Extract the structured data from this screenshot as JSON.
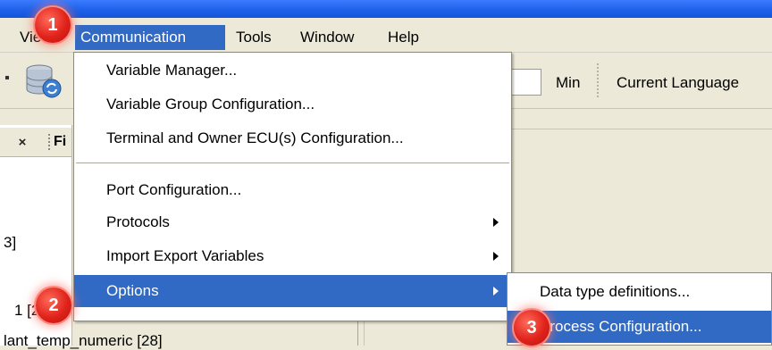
{
  "menubar": {
    "items": [
      {
        "label": "View"
      },
      {
        "label": "Communication"
      },
      {
        "label": "Tools"
      },
      {
        "label": "Window"
      },
      {
        "label": "Help"
      }
    ]
  },
  "toolbar": {
    "min_label": "Min",
    "current_language_label": "Current Language"
  },
  "left_panel": {
    "tab_label": "Fi",
    "lines": [
      "3]",
      "1 [27]",
      "lant_temp_numeric [28]"
    ]
  },
  "communication_menu": {
    "items": [
      {
        "label": "Variable Manager..."
      },
      {
        "label": "Variable Group Configuration..."
      },
      {
        "label": "Terminal and Owner ECU(s) Configuration..."
      },
      {
        "label": "Port Configuration..."
      },
      {
        "label": "Protocols"
      },
      {
        "label": "Import Export Variables"
      },
      {
        "label": "Options"
      }
    ]
  },
  "options_submenu": {
    "items": [
      {
        "label": "Data type definitions..."
      },
      {
        "label": "Process Configuration..."
      }
    ]
  },
  "badges": [
    "1",
    "2",
    "3"
  ],
  "colors": {
    "highlight": "#316ac5",
    "badge": "#e0231b",
    "title_bar": "#1c5fe8"
  }
}
